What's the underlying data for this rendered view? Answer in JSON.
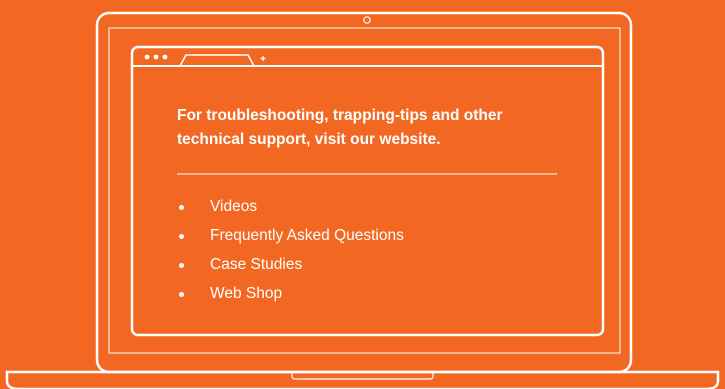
{
  "theme": {
    "background": "#f26722",
    "foreground": "#ffffff"
  },
  "browser": {
    "icons": [
      "window-dots-icon",
      "browser-tab-icon",
      "new-tab-plus-icon"
    ]
  },
  "headline": {
    "line1": "For troubleshooting, trapping-tips and other",
    "line2": "technical support, visit our website."
  },
  "links": [
    {
      "label": "Videos"
    },
    {
      "label": "Frequently Asked Questions"
    },
    {
      "label": "Case Studies"
    },
    {
      "label": "Web Shop"
    }
  ]
}
